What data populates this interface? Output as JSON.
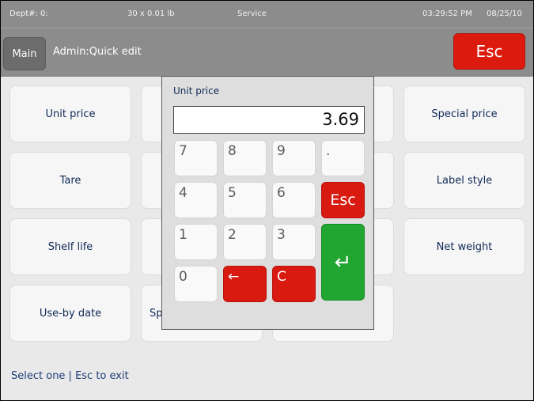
{
  "status": {
    "dept": "Dept#: 0:",
    "weight": "30 x 0.01 lb",
    "mode": "Service",
    "time": "03:29:52 PM",
    "date": "08/25/10"
  },
  "header": {
    "main_label": "Main",
    "title": "Admin:Quick edit",
    "esc_label": "Esc"
  },
  "tiles": {
    "unit_price": "Unit price",
    "tare": "Tare",
    "shelf_life": "Shelf life",
    "use_by_date": "Use-by date",
    "partial_sp": "Sp",
    "special_price": "Special price",
    "label_style": "Label style",
    "net_weight": "Net weight"
  },
  "hint": "Select one | Esc to exit",
  "keypad": {
    "title": "Unit price",
    "value": "3.69",
    "keys": {
      "k7": "7",
      "k8": "8",
      "k9": "9",
      "dot": ".",
      "k4": "4",
      "k5": "5",
      "k6": "6",
      "esc": "Esc",
      "k1": "1",
      "k2": "2",
      "k3": "3",
      "k0": "0",
      "backspace": "←",
      "clear": "C",
      "enter": "↵"
    }
  },
  "colors": {
    "header_gray": "#8c8c8c",
    "esc_red": "#dd1a0e",
    "enter_green": "#22a632",
    "text_navy": "#102a56"
  }
}
